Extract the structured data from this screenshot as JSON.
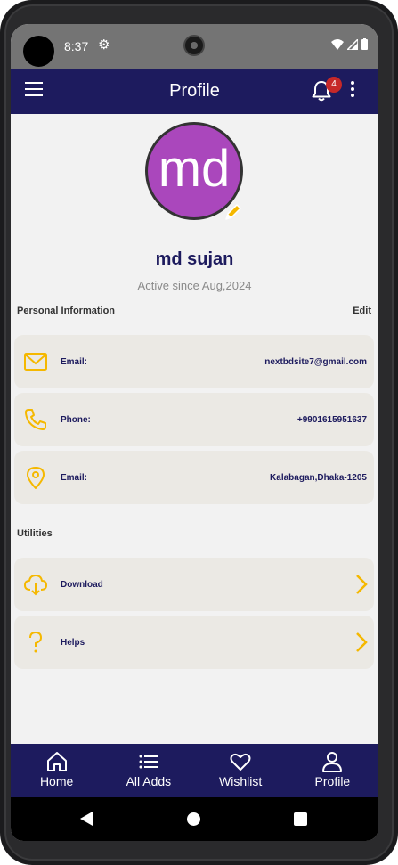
{
  "status_bar": {
    "time": "8:37"
  },
  "app_bar": {
    "title": "Profile",
    "notification_count": "4"
  },
  "profile": {
    "avatar_initials": "md",
    "avatar_color": "#aa47bc",
    "name": "md sujan",
    "active_since": "Active since Aug,2024"
  },
  "personal_info": {
    "title": "Personal Information",
    "edit_label": "Edit",
    "items": [
      {
        "icon": "mail-icon",
        "label": "Email:",
        "value": "nextbdsite7@gmail.com"
      },
      {
        "icon": "phone-icon",
        "label": "Phone:",
        "value": "+9901615951637"
      },
      {
        "icon": "location-pin-icon",
        "label": "Email:",
        "value": "Kalabagan,Dhaka-1205"
      }
    ]
  },
  "utilities": {
    "title": "Utilities",
    "items": [
      {
        "icon": "cloud-download-icon",
        "label": "Download"
      },
      {
        "icon": "question-mark-icon",
        "label": "Helps"
      }
    ]
  },
  "bottom_nav": {
    "items": [
      {
        "icon": "home-icon",
        "label": "Home"
      },
      {
        "icon": "list-icon",
        "label": "All Adds"
      },
      {
        "icon": "heart-icon",
        "label": "Wishlist"
      },
      {
        "icon": "person-icon",
        "label": "Profile"
      }
    ]
  },
  "colors": {
    "primary": "#1d1b5e",
    "accent": "#f5b800",
    "card_bg": "#ebe9e4",
    "page_bg": "#f2f2f2",
    "badge": "#c62828"
  }
}
